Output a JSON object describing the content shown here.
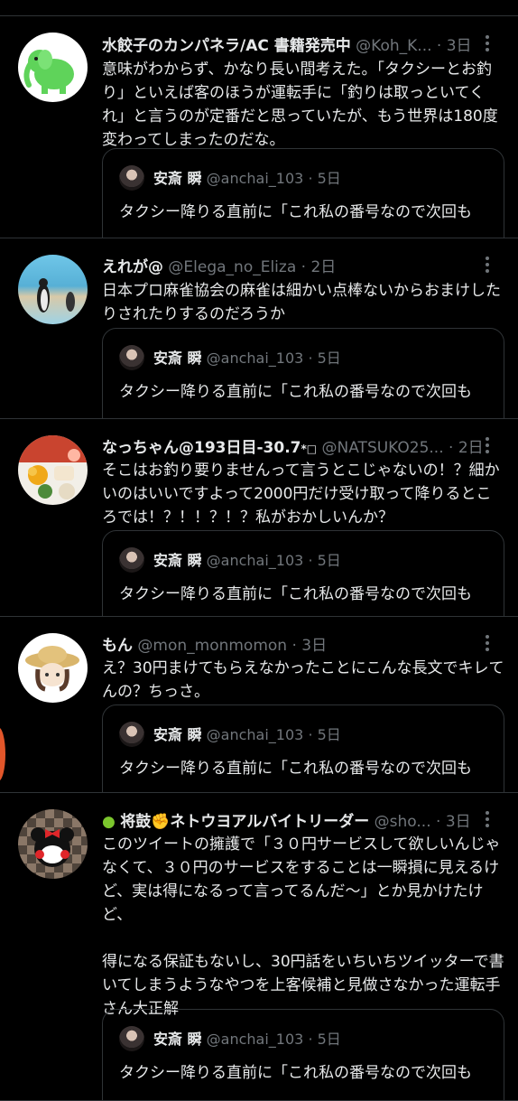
{
  "tweets": [
    {
      "name": "水餃子のカンパネラ/AC 書籍発売中",
      "handle": "@Koh_K...",
      "time": "3日",
      "body": "意味がわからず、かなり長い間考えた。「タクシーとお釣り」といえば客のほうが運転手に「釣りは取っといてくれ」と言うのが定番だと思っていたが、もう世界は180度変わってしまったのだな。",
      "quote": {
        "name": "安斎 瞬",
        "handle": "@anchai_103",
        "time": "5日",
        "text": "タクシー降りる直前に「これ私の番号なので次回も"
      }
    },
    {
      "name": "えれが@",
      "handle": "@Elega_no_Eliza",
      "time": "2日",
      "body": "日本プロ麻雀協会の麻雀は細かい点棒ないからおまけしたりされたりするのだろうか",
      "quote": {
        "name": "安斎 瞬",
        "handle": "@anchai_103",
        "time": "5日",
        "text": "タクシー降りる直前に「これ私の番号なので次回も"
      }
    },
    {
      "name": "なっちゃん@193日目-30.7",
      "handle": "@NATSUKO25...",
      "time": "2日",
      "body": "そこはお釣り要りませんって言うとこじゃないの！？細かいのはいいですよって2000円だけ受け取って降りるところでは！？！！？！？私がおかしいんか？",
      "quote": {
        "name": "安斎 瞬",
        "handle": "@anchai_103",
        "time": "5日",
        "text": "タクシー降りる直前に「これ私の番号なので次回も"
      }
    },
    {
      "name": "もん",
      "handle": "@mon_monmomon",
      "time": "3日",
      "body": "え？30円まけてもらえなかったことにこんな長文でキレてんの？ちっさ。",
      "quote": {
        "name": "安斎 瞬",
        "handle": "@anchai_103",
        "time": "5日",
        "text": "タクシー降りる直前に「これ私の番号なので次回も"
      }
    },
    {
      "name": "将鼓",
      "name2": "ネトウヨアルバイトリーダー",
      "handle": "@sho...",
      "time": "3日",
      "body": "このツイートの擁護で「３０円サービスして欲しいんじゃなくて、３０円のサービスをすることは一瞬損に見えるけど、実は得になるって言ってるんだ〜」とか見かけたけど、\n\n得になる保証もないし、30円話をいちいちツイッターで書いてしまうようなやつを上客候補と見做さなかった運転手さん大正解",
      "quote": {
        "name": "安斎 瞬",
        "handle": "@anchai_103",
        "time": "5日",
        "text": "タクシー降りる直前に「これ私の番号なので次回も"
      }
    }
  ],
  "separator": "·",
  "colors": {
    "background": "#000000",
    "text": "#e7e9ea",
    "muted": "#71767b",
    "border": "#2f3336"
  }
}
